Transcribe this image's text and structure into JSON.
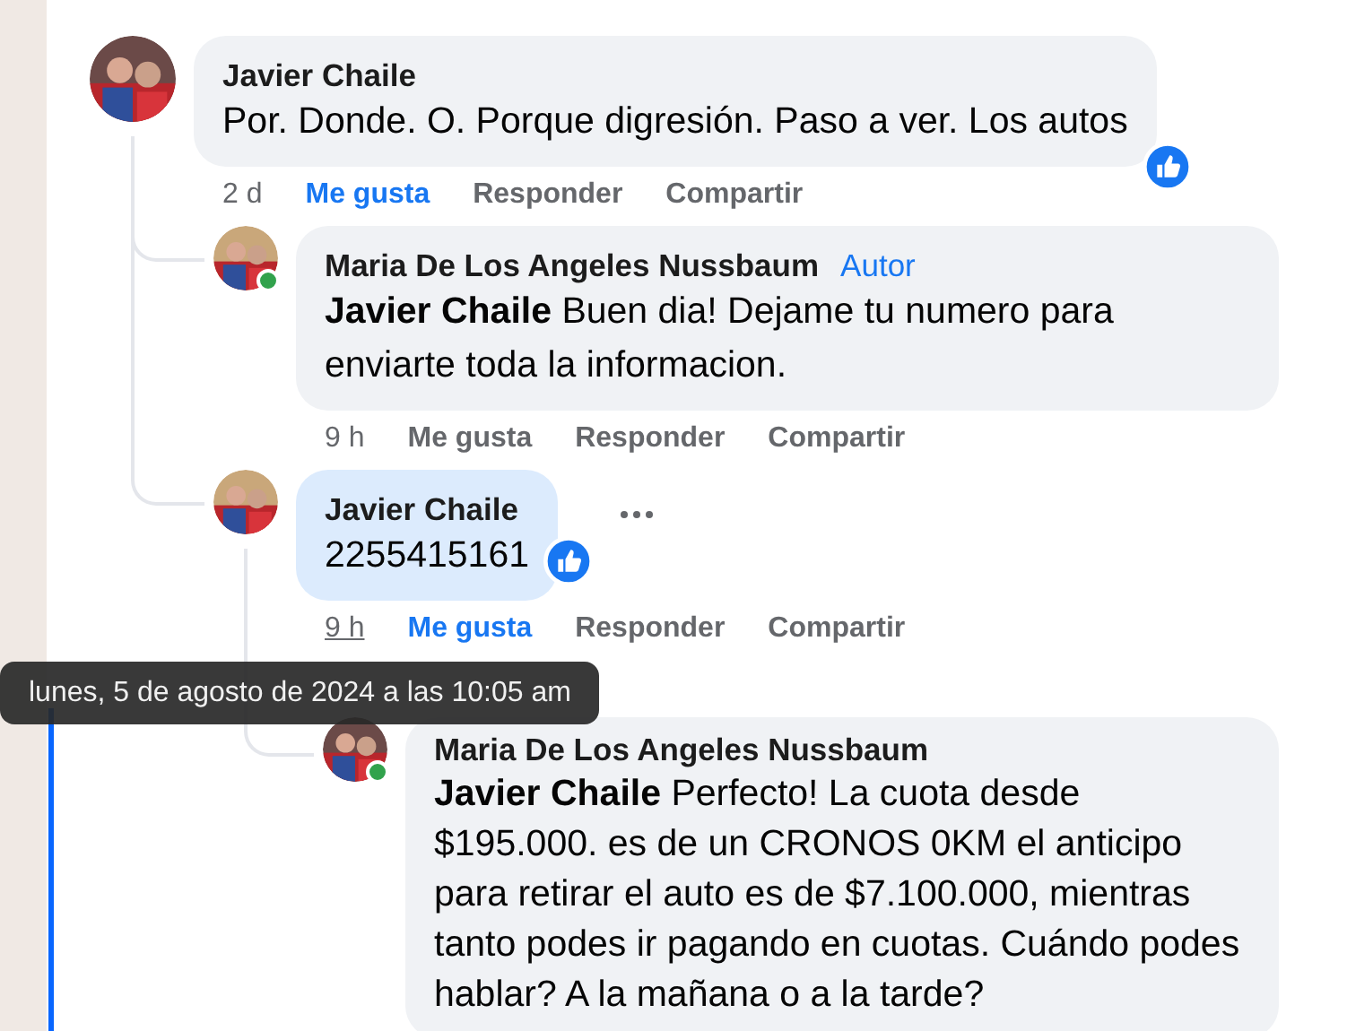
{
  "comments": [
    {
      "author": "Javier Chaile",
      "text": "Por. Donde. O. Porque digresión. Paso a ver. Los autos",
      "online": false,
      "liked_reaction": true,
      "more_menu": false,
      "highlighted": false,
      "time": "2 d",
      "time_hover": false,
      "actions": [
        {
          "label": "Me gusta",
          "active": true
        },
        {
          "label": "Responder",
          "active": false
        },
        {
          "label": "Compartir",
          "active": false
        }
      ],
      "children": [
        {
          "author": "Maria De Los Angeles Nussbaum",
          "badge": "Autor",
          "text": "**Javier Chaile** Buen dia! Dejame tu numero para enviarte toda la informacion.",
          "online": true,
          "liked_reaction": false,
          "more_menu": false,
          "highlighted": false,
          "time": "9 h",
          "time_hover": false,
          "actions": [
            {
              "label": "Me gusta",
              "active": false
            },
            {
              "label": "Responder",
              "active": false
            },
            {
              "label": "Compartir",
              "active": false
            }
          ]
        },
        {
          "author": "Javier Chaile",
          "text": "2255415161",
          "online": false,
          "liked_reaction": true,
          "more_menu": true,
          "highlighted": true,
          "time": "9 h",
          "time_hover": true,
          "actions": [
            {
              "label": "Me gusta",
              "active": true
            },
            {
              "label": "Responder",
              "active": false
            },
            {
              "label": "Compartir",
              "active": false
            }
          ],
          "children": [
            {
              "author": "Maria De Los Angeles Nussbaum",
              "text": "**Javier Chaile** Perfecto! La cuota desde $195.000. es de un CRONOS 0KM el anticipo para retirar el auto es de $7.100.000, mientras tanto podes ir pagando en cuotas. Cuándo podes hablar? A la mañana o a la tarde?",
              "online": true,
              "liked_reaction": false,
              "more_menu": false,
              "highlighted": false
            }
          ]
        }
      ]
    }
  ],
  "tooltip": {
    "text": "lunes, 5 de agosto de 2024 a las 10:05 am"
  }
}
